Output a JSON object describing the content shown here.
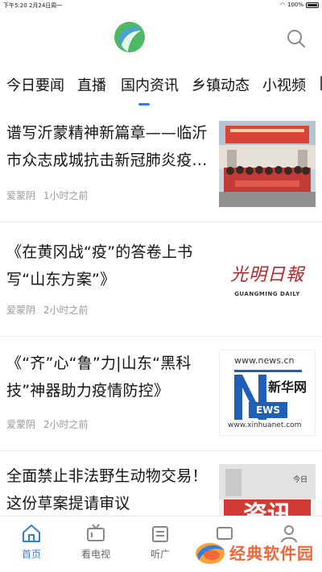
{
  "status_bar": {
    "time_date": "下午5:20   2月24日周一",
    "battery": "100%"
  },
  "header": {
    "logo_icon": "app-logo",
    "search_icon": "search-icon"
  },
  "tabs": [
    {
      "label": "今日要闻"
    },
    {
      "label": "直播"
    },
    {
      "label": "国内资讯",
      "active": true
    },
    {
      "label": "乡镇动态"
    },
    {
      "label": "小视频"
    }
  ],
  "feed": [
    {
      "title": "谱写沂蒙精神新篇章——临沂市众志成城抗击新冠肺炎疫…",
      "source": "爱蒙阴",
      "time": "1小时之前",
      "thumb": "group-photo"
    },
    {
      "title": "《在黄冈战“疫”的答卷上书写“山东方案”》",
      "source": "爱蒙阴",
      "time": "2小时之前",
      "thumb": {
        "logo_cn": "光明日報",
        "logo_en": "GUANGMING DAILY"
      }
    },
    {
      "title": "《“齐”心“鲁”力|山东“黑科技”神器助力疫情防控》",
      "source": "爱蒙阴",
      "time": "2小时之前",
      "thumb": {
        "top": "www.news.cn",
        "brand": "新华网",
        "bottom": "www.xinhuanet.com"
      }
    },
    {
      "title": "全面禁止非法野生动物交易！这份草案提请审议",
      "source": "",
      "time": "",
      "thumb": {
        "text": "资讯",
        "corner": "今日"
      }
    }
  ],
  "bottom_nav": [
    {
      "label": "首页",
      "icon": "home-icon",
      "active": true
    },
    {
      "label": "看电视",
      "icon": "tv-icon"
    },
    {
      "label": "听广",
      "icon": "radio-icon"
    },
    {
      "label": "",
      "icon": "media-icon"
    },
    {
      "label": "",
      "icon": "profile-icon"
    }
  ],
  "watermark": {
    "text": "经典软件园"
  },
  "colors": {
    "accent": "#2f7fe0",
    "watermark": "#f0683a"
  }
}
